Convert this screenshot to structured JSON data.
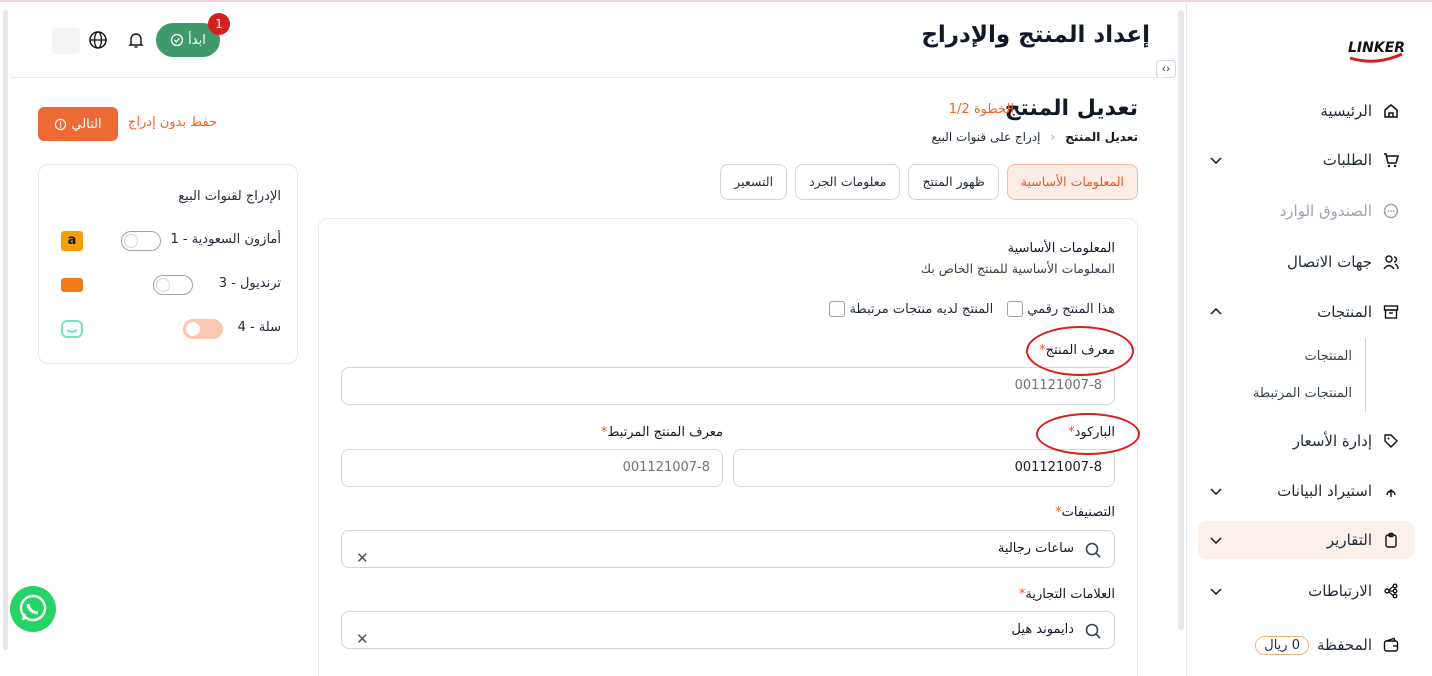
{
  "sidebar": {
    "logo_text": "LINKER",
    "items": [
      {
        "label": "الرئيسية",
        "icon": "home-icon"
      },
      {
        "label": "الطلبات",
        "icon": "cart-icon"
      },
      {
        "label": "الصندوق الوارد",
        "icon": "chat-icon"
      },
      {
        "label": "جهات الاتصال",
        "icon": "users-icon"
      },
      {
        "label": "المنتجات",
        "icon": "box-icon"
      },
      {
        "label": "إدارة الأسعار",
        "icon": "tag-icon"
      },
      {
        "label": "استيراد البيانات",
        "icon": "upload-icon"
      },
      {
        "label": "التقارير",
        "icon": "clipboard-icon"
      },
      {
        "label": "الارتباطات",
        "icon": "link-icon"
      },
      {
        "label": "المحفظة",
        "icon": "wallet-icon"
      }
    ],
    "products_sub": [
      "المنتجات",
      "المنتجات المرتبطة"
    ],
    "wallet_badge": "0 ريال"
  },
  "header": {
    "title": "إعداد المنتج والإدراج",
    "start_label": "ابدأ",
    "badge_count": "1"
  },
  "page": {
    "title": "تعديل المنتج",
    "step": "الخطوة 1/2",
    "breadcrumb_current": "تعديل المنتج",
    "breadcrumb_next": "إدراج على قنوات البيع",
    "next_label": "التالي",
    "save_label": "حفظ بدون إدراج"
  },
  "tabs": [
    "المعلومات الأساسية",
    "ظهور المنتج",
    "معلومات الجرد",
    "التسعير"
  ],
  "channels": {
    "title": "الإدراج لقنوات البيع",
    "items": [
      {
        "label": "أمازون السعودية - 1",
        "on": false,
        "color": "#f59e0b"
      },
      {
        "label": "ترنديول - 3",
        "on": false,
        "color": "#f27a1a"
      },
      {
        "label": "سلة - 4",
        "on": true,
        "color": "#76e3c8"
      }
    ]
  },
  "form": {
    "section_title": "المعلومات الأساسية",
    "section_sub": "المعلومات الأساسية للمنتج الخاص بك",
    "check_related": "المنتج لديه منتجات مرتبطة",
    "check_digital": "هذا المنتج رقمي",
    "product_id_label": "معرف المنتج",
    "product_id_value": "001121007-8",
    "barcode_label": "الباركود",
    "barcode_value": "001121007-8",
    "related_id_label": "معرف المنتج المرتبط",
    "related_id_value": "001121007-8",
    "categories_label": "التصنيفات",
    "categories_value": "ساعات رجالية",
    "brands_label": "العلامات التجارية",
    "brands_value": "دايموند هيل",
    "required_mark": "*"
  },
  "colors": {
    "accent": "#ee6a34",
    "green": "#3f9a6b",
    "annotation": "#d81e1e"
  }
}
